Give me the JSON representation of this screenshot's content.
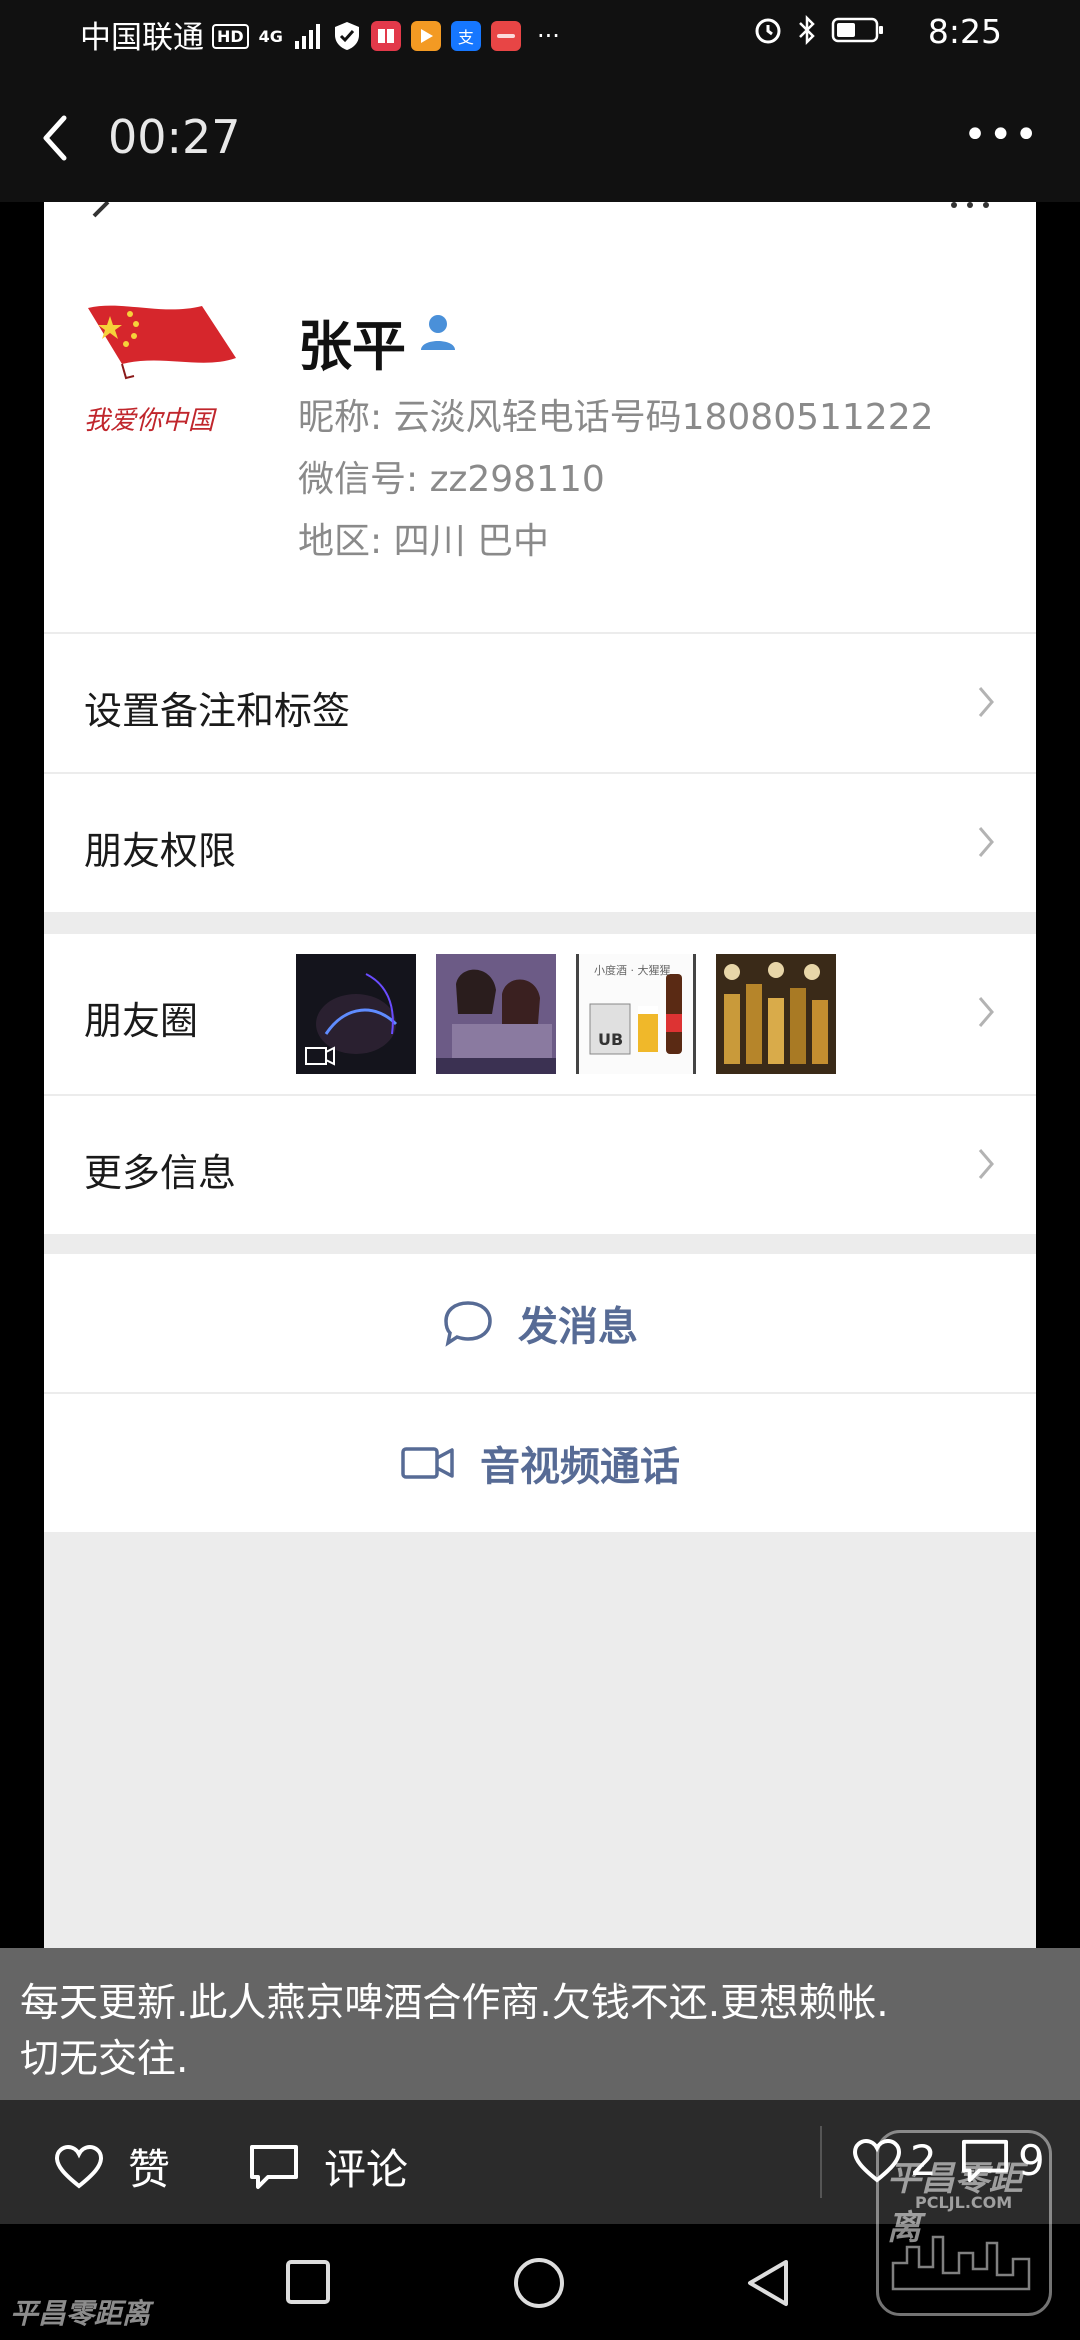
{
  "status_bar": {
    "carrier": "中国联通",
    "hd_badge": "HD",
    "network": "4G",
    "icons": [
      "signal-icon",
      "shield-icon",
      "book-app-icon",
      "video-app-icon",
      "alipay-icon",
      "huawei-app-icon",
      "more-dots"
    ],
    "app_badges": [
      "支"
    ],
    "overflow": "···",
    "right_icons": [
      "alarm-icon",
      "bluetooth-icon",
      "battery-icon"
    ],
    "time": "8:25"
  },
  "video_header": {
    "elapsed": "00:27",
    "more": "•••"
  },
  "profile": {
    "name": "张平",
    "nickname": "昵称: 云淡风轻电话号码18080511222",
    "wechat_id": "微信号: zz298110",
    "region": "地区: 四川  巴中",
    "avatar_caption": "我爱你中国"
  },
  "menu": {
    "remark_tags": "设置备注和标签",
    "friend_permissions": "朋友权限",
    "moments": "朋友圈",
    "more_info": "更多信息"
  },
  "moments_thumbs": [
    "video-thumb",
    "people-thumb",
    "beer-ad-thumb",
    "bottles-thumb"
  ],
  "beer_ad_text": "小度酒 · 大猩猩",
  "beer_ad_label": "UB",
  "actions": {
    "send_message": "发消息",
    "av_call": "音视频通话"
  },
  "caption": {
    "line1": "每天更新.此人燕京啤酒合作商.欠钱不还.更想赖帐.",
    "line2": "切无交往."
  },
  "engage": {
    "like": "赞",
    "comment": "评论",
    "like_count": "2",
    "comment_count": "9"
  },
  "watermark": {
    "brand": "平昌零距离",
    "site": "PCLJL.COM"
  },
  "colors": {
    "link_blue": "#576b95",
    "dark_bg": "#111111",
    "card_gray": "#ececec"
  }
}
